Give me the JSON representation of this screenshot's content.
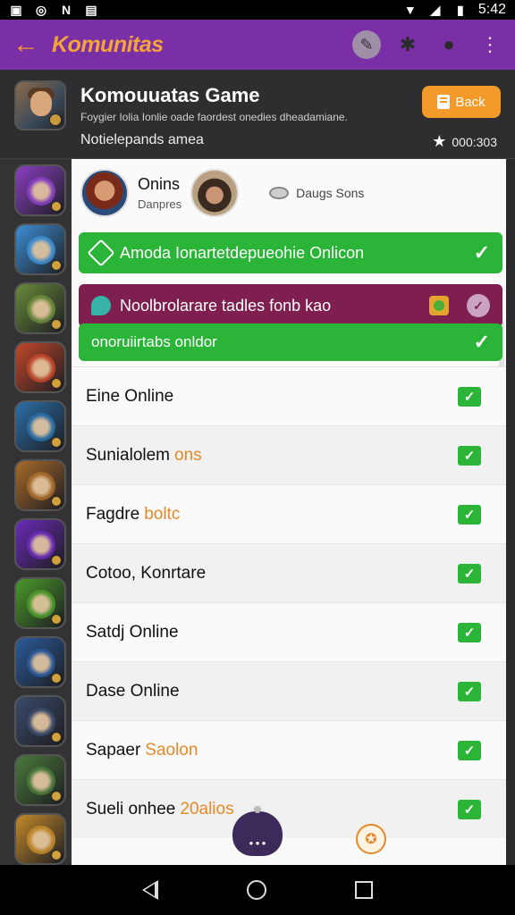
{
  "status_bar": {
    "time": "5:42"
  },
  "app_bar": {
    "title": "Komunitas"
  },
  "header": {
    "title": "Komouuatas Game",
    "subtitle": "Foygier Iolia Ionlie oade faordest onedies dheadamiane.",
    "subtitle2": "Notielepands amea",
    "back_label": "Back",
    "rating": "000:303"
  },
  "friends": {
    "name": "Onins",
    "role": "Danpres",
    "link_label": "Daugs Sons"
  },
  "banners": [
    {
      "text": "Amoda Ionartetdepueohie Onlicon"
    },
    {
      "text": "Noolbrolarare tadles fonb kao"
    },
    {
      "text": "onoruiirtabs onldor"
    }
  ],
  "rows": [
    {
      "label": "Eine Online",
      "accent": ""
    },
    {
      "label": "Sunialolem",
      "accent": "ons"
    },
    {
      "label": "Fagdre",
      "accent": "boltc"
    },
    {
      "label": "Cotoo, Konrtare",
      "accent": ""
    },
    {
      "label": "Satdj Online",
      "accent": ""
    },
    {
      "label": "Dase Online",
      "accent": ""
    },
    {
      "label": "Sapaer",
      "accent": "Saolon"
    },
    {
      "label": "Sueli onhee",
      "accent": "20alios"
    }
  ],
  "colors": {
    "app_bar": "#7a2fa6",
    "accent_orange": "#f39a2a",
    "success_green": "#2bb538",
    "banner_purple": "#7e1f4f"
  },
  "sidebar_icon_colors": [
    "#8a3fc2",
    "#3d8fd6",
    "#6a8a3a",
    "#c2472a",
    "#2a6fa8",
    "#a86a2a",
    "#6a2ab8",
    "#4a9a2a",
    "#2a5a9a",
    "#3a4a6a",
    "#4a7a3a",
    "#c48a2a"
  ]
}
